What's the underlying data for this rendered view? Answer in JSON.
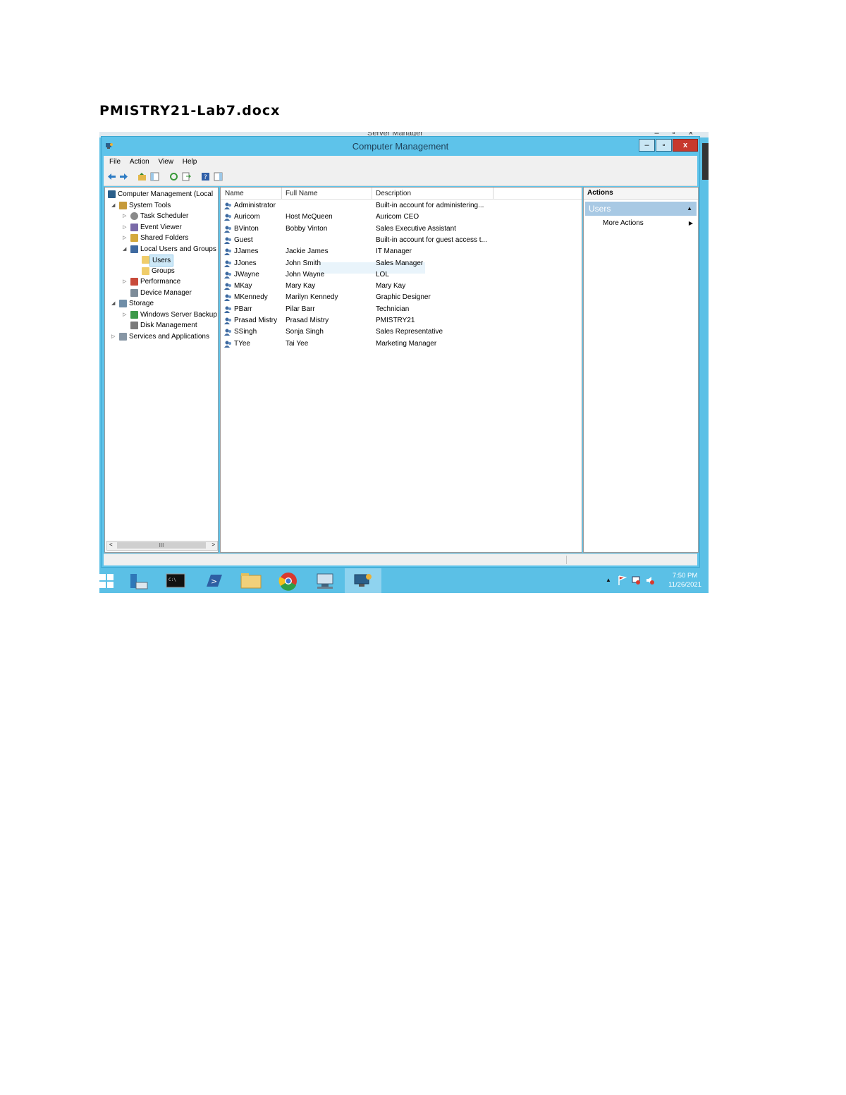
{
  "document": {
    "title": "PMISTRY21-Lab7.docx"
  },
  "background_window": {
    "title": "Server Manager",
    "controls": "– ▫ ×"
  },
  "window": {
    "title": "Computer Management",
    "controls": {
      "minimize": "–",
      "maximize": "▫",
      "close": "x"
    }
  },
  "menu": [
    "File",
    "Action",
    "View",
    "Help"
  ],
  "toolbar_icons": [
    "back-icon",
    "forward-icon",
    "up-folder-icon",
    "show-hide-tree-icon",
    "refresh-icon",
    "export-list-icon",
    "help-icon",
    "show-hide-action-pane-icon"
  ],
  "tree": [
    {
      "label": "Computer Management (Local",
      "icon": "computer-management-icon",
      "arrow": "",
      "level": 0
    },
    {
      "label": "System Tools",
      "icon": "system-tools-icon",
      "arrow": "◢",
      "level": 1
    },
    {
      "label": "Task Scheduler",
      "icon": "clock-icon",
      "arrow": "▷",
      "level": 2
    },
    {
      "label": "Event Viewer",
      "icon": "event-viewer-icon",
      "arrow": "▷",
      "level": 2
    },
    {
      "label": "Shared Folders",
      "icon": "shared-folder-icon",
      "arrow": "▷",
      "level": 2
    },
    {
      "label": "Local Users and Groups",
      "icon": "users-icon",
      "arrow": "◢",
      "level": 2
    },
    {
      "label": "Users",
      "icon": "folder-icon",
      "arrow": "",
      "level": 3,
      "selected": true
    },
    {
      "label": "Groups",
      "icon": "folder-icon",
      "arrow": "",
      "level": 3
    },
    {
      "label": "Performance",
      "icon": "performance-icon",
      "arrow": "▷",
      "level": 2
    },
    {
      "label": "Device Manager",
      "icon": "device-manager-icon",
      "arrow": "",
      "level": 2
    },
    {
      "label": "Storage",
      "icon": "storage-icon",
      "arrow": "◢",
      "level": 1
    },
    {
      "label": "Windows Server Backup",
      "icon": "backup-icon",
      "arrow": "▷",
      "level": 2
    },
    {
      "label": "Disk Management",
      "icon": "disk-icon",
      "arrow": "",
      "level": 2
    },
    {
      "label": "Services and Applications",
      "icon": "services-icon",
      "arrow": "▷",
      "level": 1
    }
  ],
  "tree_scroll": {
    "left": "<",
    "right": ">",
    "thumb": "III"
  },
  "list": {
    "columns": [
      "Name",
      "Full Name",
      "Description"
    ],
    "rows": [
      {
        "name": "Administrator",
        "full_name": "",
        "description": "Built-in account for administering..."
      },
      {
        "name": "Auricom",
        "full_name": "Host McQueen",
        "description": "Auricom CEO"
      },
      {
        "name": "BVinton",
        "full_name": "Bobby Vinton",
        "description": "Sales Executive Assistant"
      },
      {
        "name": "Guest",
        "full_name": "",
        "description": "Built-in account for guest access t..."
      },
      {
        "name": "JJames",
        "full_name": "Jackie James",
        "description": "IT Manager"
      },
      {
        "name": "JJones",
        "full_name": "John Smith",
        "description": "Sales Manager"
      },
      {
        "name": "JWayne",
        "full_name": "John Wayne",
        "description": "LOL"
      },
      {
        "name": "MKay",
        "full_name": "Mary Kay",
        "description": "Mary Kay"
      },
      {
        "name": "MKennedy",
        "full_name": "Marilyn Kennedy",
        "description": "Graphic Designer"
      },
      {
        "name": "PBarr",
        "full_name": "Pilar Barr",
        "description": "Technician"
      },
      {
        "name": "Prasad Mistry",
        "full_name": "Prasad Mistry",
        "description": "PMISTRY21"
      },
      {
        "name": "SSingh",
        "full_name": "Sonja Singh",
        "description": "Sales Representative"
      },
      {
        "name": "TYee",
        "full_name": "Tai Yee",
        "description": "Marketing Manager"
      }
    ]
  },
  "actions": {
    "header": "Actions",
    "section": "Users",
    "section_arrow": "▲",
    "items": [
      {
        "label": "More Actions",
        "arrow": "▶"
      }
    ]
  },
  "taskbar": {
    "apps": [
      "server-manager-icon",
      "command-prompt-icon",
      "powershell-icon",
      "file-explorer-icon",
      "chrome-icon",
      "network-icon",
      "computer-management-icon"
    ],
    "tray_arrow": "▲",
    "time": "7:50 PM",
    "date": "11/26/2021"
  },
  "colors": {
    "titlebar": "#5ec3ea",
    "close": "#c7392d",
    "taskbar": "#5bc0e6",
    "selection": "#cde8f7"
  }
}
